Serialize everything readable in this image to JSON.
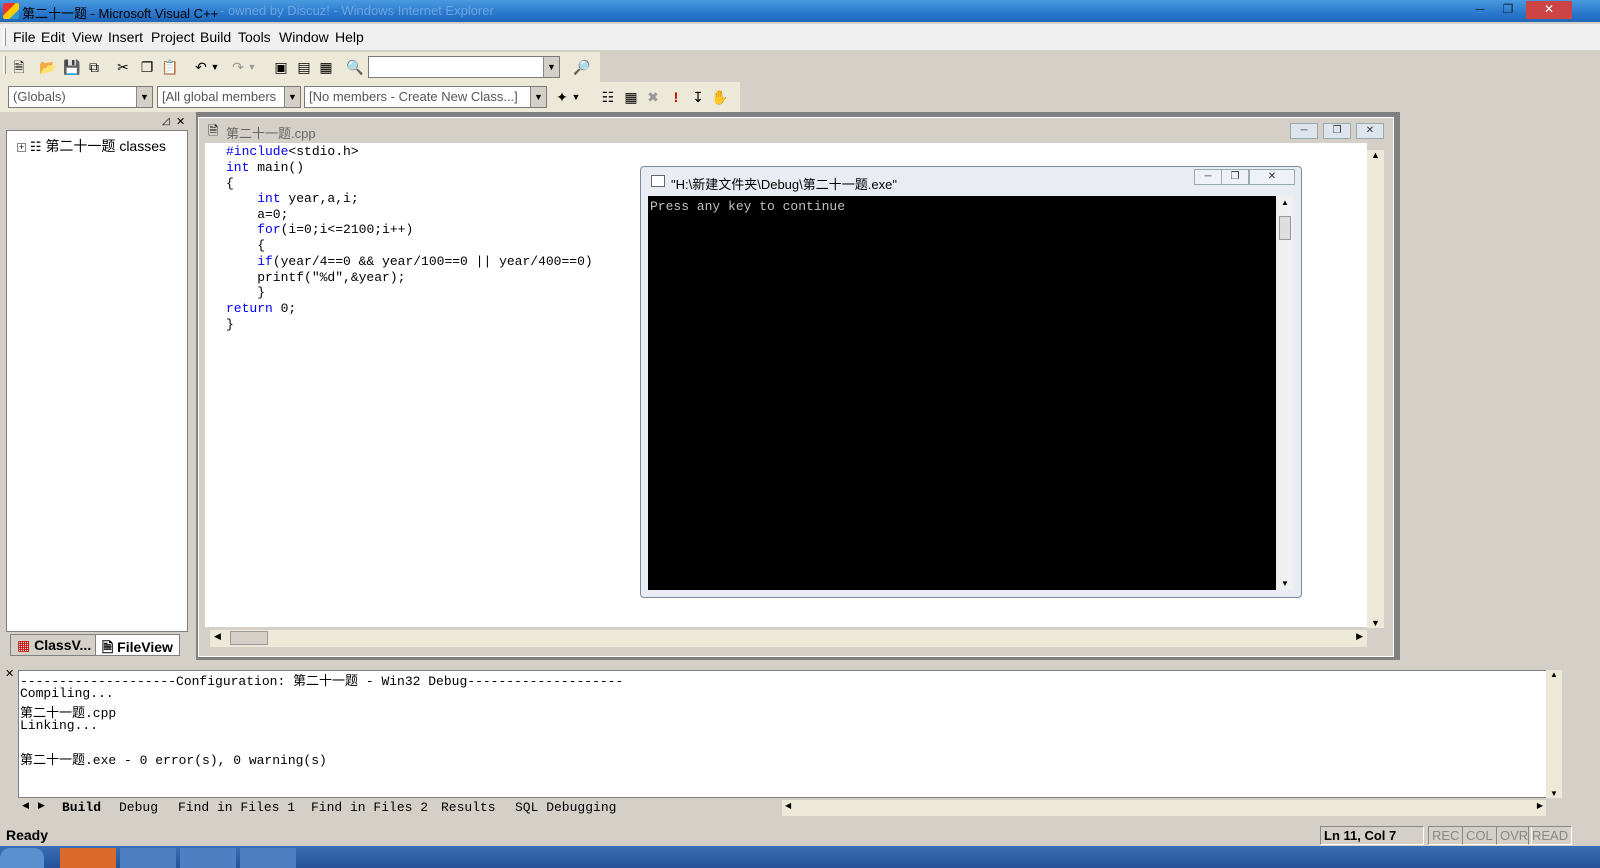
{
  "window": {
    "title": "第二十一题 - Microsoft Visual C++",
    "ghost_title": "- owned by Discuz! - Windows Internet Explorer"
  },
  "menu": [
    "File",
    "Edit",
    "View",
    "Insert",
    "Project",
    "Build",
    "Tools",
    "Window",
    "Help"
  ],
  "toolbar2": {
    "globals_combo": "(Globals)",
    "members_combo": "[All global members",
    "class_combo": "[No members - Create New Class...]"
  },
  "workspace": {
    "tree_root": "第二十一题 classes",
    "tabs": [
      "ClassV...",
      "FileView"
    ]
  },
  "editor": {
    "filename": "第二十一题.cpp",
    "lines": [
      "#include<stdio.h>",
      "int main()",
      "{",
      "    int year,a,i;",
      "    a=0;",
      "    for(i=0;i<=2100;i++)",
      "    {",
      "    if(year/4==0 && year/100==0 || year/400==0)",
      "    printf(\"%d\",&year);",
      "    }",
      "return 0;",
      "}"
    ]
  },
  "console": {
    "title": "\"H:\\新建文件夹\\Debug\\第二十一题.exe\"",
    "output": "Press any key to continue"
  },
  "output_pane": {
    "lines": [
      "--------------------Configuration: 第二十一题 - Win32 Debug--------------------",
      "Compiling...",
      "第二十一题.cpp",
      "Linking...",
      "",
      "第二十一题.exe - 0 error(s), 0 warning(s)"
    ],
    "tabs": [
      "Build",
      "Debug",
      "Find in Files 1",
      "Find in Files 2",
      "Results",
      "SQL Debugging"
    ]
  },
  "status": {
    "message": "Ready",
    "position": "Ln 11, Col 7",
    "indicators": [
      "REC",
      "COL",
      "OVR",
      "READ"
    ]
  }
}
